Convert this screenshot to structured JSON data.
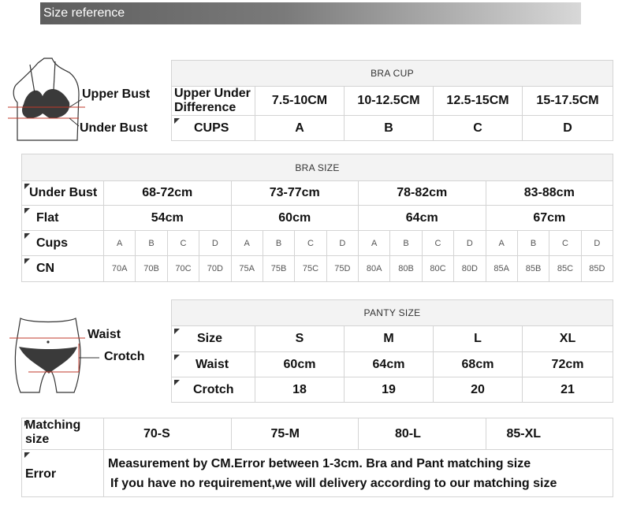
{
  "header": {
    "title": "Size reference"
  },
  "bust_figure": {
    "upper_label": "Upper Bust",
    "under_label": "Under Bust"
  },
  "bra_cup": {
    "title": "BRA CUP",
    "rows": [
      {
        "label": "Upper Under Difference",
        "cells": [
          "7.5-10CM",
          "10-12.5CM",
          "12.5-15CM",
          "15-17.5CM"
        ]
      },
      {
        "label": "CUPS",
        "cells": [
          "A",
          "B",
          "C",
          "D"
        ]
      }
    ]
  },
  "bra_size": {
    "title": "BRA SIZE",
    "under_bust": {
      "label": "Under Bust",
      "cells": [
        "68-72cm",
        "73-77cm",
        "78-82cm",
        "83-88cm"
      ]
    },
    "flat": {
      "label": "Flat",
      "cells": [
        "54cm",
        "60cm",
        "64cm",
        "67cm"
      ]
    },
    "cups": {
      "label": "Cups",
      "cells": [
        "A",
        "B",
        "C",
        "D",
        "A",
        "B",
        "C",
        "D",
        "A",
        "B",
        "C",
        "D",
        "A",
        "B",
        "C",
        "D"
      ]
    },
    "cn": {
      "label": "CN",
      "cells": [
        "70A",
        "70B",
        "70C",
        "70D",
        "75A",
        "75B",
        "75C",
        "75D",
        "80A",
        "80B",
        "80C",
        "80D",
        "85A",
        "85B",
        "85C",
        "85D"
      ]
    }
  },
  "panty_figure": {
    "waist_label": "Waist",
    "crotch_label": "Crotch"
  },
  "panty_size": {
    "title": "PANTY SIZE",
    "rows": [
      {
        "label": "Size",
        "cells": [
          "S",
          "M",
          "L",
          "XL"
        ]
      },
      {
        "label": "Waist",
        "cells": [
          "60cm",
          "64cm",
          "68cm",
          "72cm"
        ]
      },
      {
        "label": "Crotch",
        "cells": [
          "18",
          "19",
          "20",
          "21"
        ]
      }
    ]
  },
  "matching": {
    "label": "Matching size",
    "cells": [
      "70-S",
      "75-M",
      "80-L",
      "85-XL"
    ],
    "error_label": "Error",
    "error_line1": "Measurement by CM.Error between 1-3cm. Bra and Pant matching size",
    "error_line2": "If you have no requirement,we will delivery according to our matching size"
  }
}
